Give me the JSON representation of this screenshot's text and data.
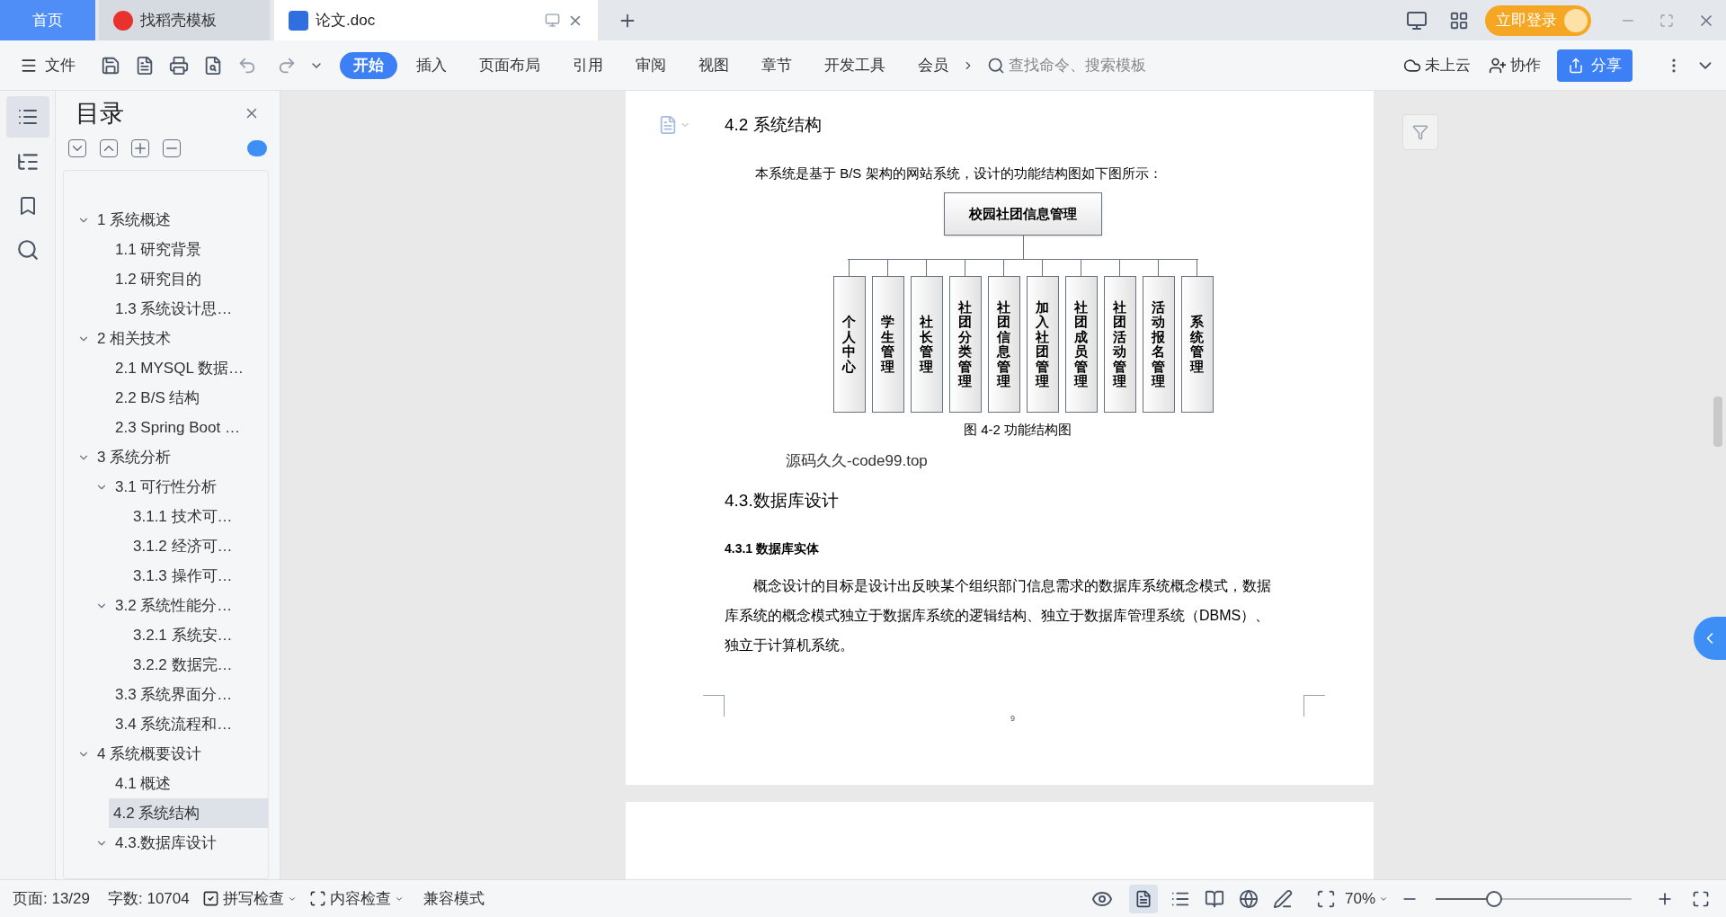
{
  "doc_tabs": [
    {
      "label": "首页",
      "kind": "home",
      "selected": false
    },
    {
      "label": "找稻壳模板",
      "kind": "template",
      "selected": false
    },
    {
      "label": "论文.doc",
      "kind": "doc",
      "selected": true
    }
  ],
  "login_button": "立即登录",
  "file_menu": "文件",
  "ribbon_tabs": [
    {
      "label": "开始",
      "selected": true
    },
    {
      "label": "插入",
      "selected": false
    },
    {
      "label": "页面布局",
      "selected": false
    },
    {
      "label": "引用",
      "selected": false
    },
    {
      "label": "审阅",
      "selected": false
    },
    {
      "label": "视图",
      "selected": false
    },
    {
      "label": "章节",
      "selected": false
    },
    {
      "label": "开发工具",
      "selected": false
    },
    {
      "label": "会员",
      "selected": false
    }
  ],
  "search": {
    "placeholder": "查找命令、搜索模板"
  },
  "cloud": "未上云",
  "collab": "协作",
  "share": "分享",
  "toc": {
    "title": "目录",
    "items": [
      {
        "label": "1 系统概述",
        "expanded": true,
        "selected": false,
        "children": [
          {
            "label": "1.1  研究背景",
            "selected": false
          },
          {
            "label": "1.2 研究目的",
            "selected": false
          },
          {
            "label": "1.3 系统设计思…",
            "selected": false
          }
        ]
      },
      {
        "label": "2 相关技术",
        "expanded": true,
        "selected": false,
        "children": [
          {
            "label": "2.1 MYSQL 数据…",
            "selected": false
          },
          {
            "label": "2.2 B/S 结构",
            "selected": false
          },
          {
            "label": "2.3 Spring Boot …",
            "selected": false
          }
        ]
      },
      {
        "label": "3 系统分析",
        "expanded": true,
        "selected": false,
        "children": [
          {
            "label": "3.1 可行性分析",
            "expanded": true,
            "selected": false,
            "children": [
              {
                "label": "3.1.1 技术可…",
                "selected": false
              },
              {
                "label": "3.1.2 经济可…",
                "selected": false
              },
              {
                "label": "3.1.3 操作可…",
                "selected": false
              }
            ]
          },
          {
            "label": "3.2 系统性能分…",
            "expanded": true,
            "selected": false,
            "children": [
              {
                "label": "3.2.1  系统安…",
                "selected": false
              },
              {
                "label": "3.2.2  数据完…",
                "selected": false
              }
            ]
          },
          {
            "label": "3.3 系统界面分…",
            "selected": false
          },
          {
            "label": "3.4 系统流程和…",
            "selected": false
          }
        ]
      },
      {
        "label": "4 系统概要设计",
        "expanded": true,
        "selected": false,
        "children": [
          {
            "label": "4.1 概述",
            "selected": false
          },
          {
            "label": "4.2 系统结构",
            "selected": true
          },
          {
            "label": "4.3.数据库设计",
            "expanded": true,
            "selected": false
          }
        ]
      }
    ]
  },
  "document": {
    "heading": "4.2 系统结构",
    "intro": "本系统是基于 B/S 架构的网站系统，设计的功能结构图如下图所示：",
    "diagram": {
      "root": "校园社团信息管理",
      "children": [
        "个人中心",
        "学生管理",
        "社长管理",
        "社团分类管理",
        "社团信息管理",
        "加入社团管理",
        "社团成员管理",
        "社团活动管理",
        "活动报名管理",
        "系统管理"
      ]
    },
    "caption": "图 4-2 功能结构图",
    "stamp": "源码久久-code99.top",
    "section": "4.3.数据库设计",
    "subsection": "4.3.1 数据库实体",
    "paragraph": "概念设计的目标是设计出反映某个组织部门信息需求的数据库系统概念模式，数据库系统的概念模式独立于数据库系统的逻辑结构、独立于数据库管理系统（DBMS）、独立于计算机系统。",
    "page_number": "9"
  },
  "status_bar": {
    "page": "页面: 13/29",
    "words": "字数: 10704",
    "spell": "拼写检查",
    "content_check": "内容检查",
    "compat": "兼容模式",
    "zoom": "70%",
    "zoom_slider": {
      "level": 0.3
    }
  }
}
